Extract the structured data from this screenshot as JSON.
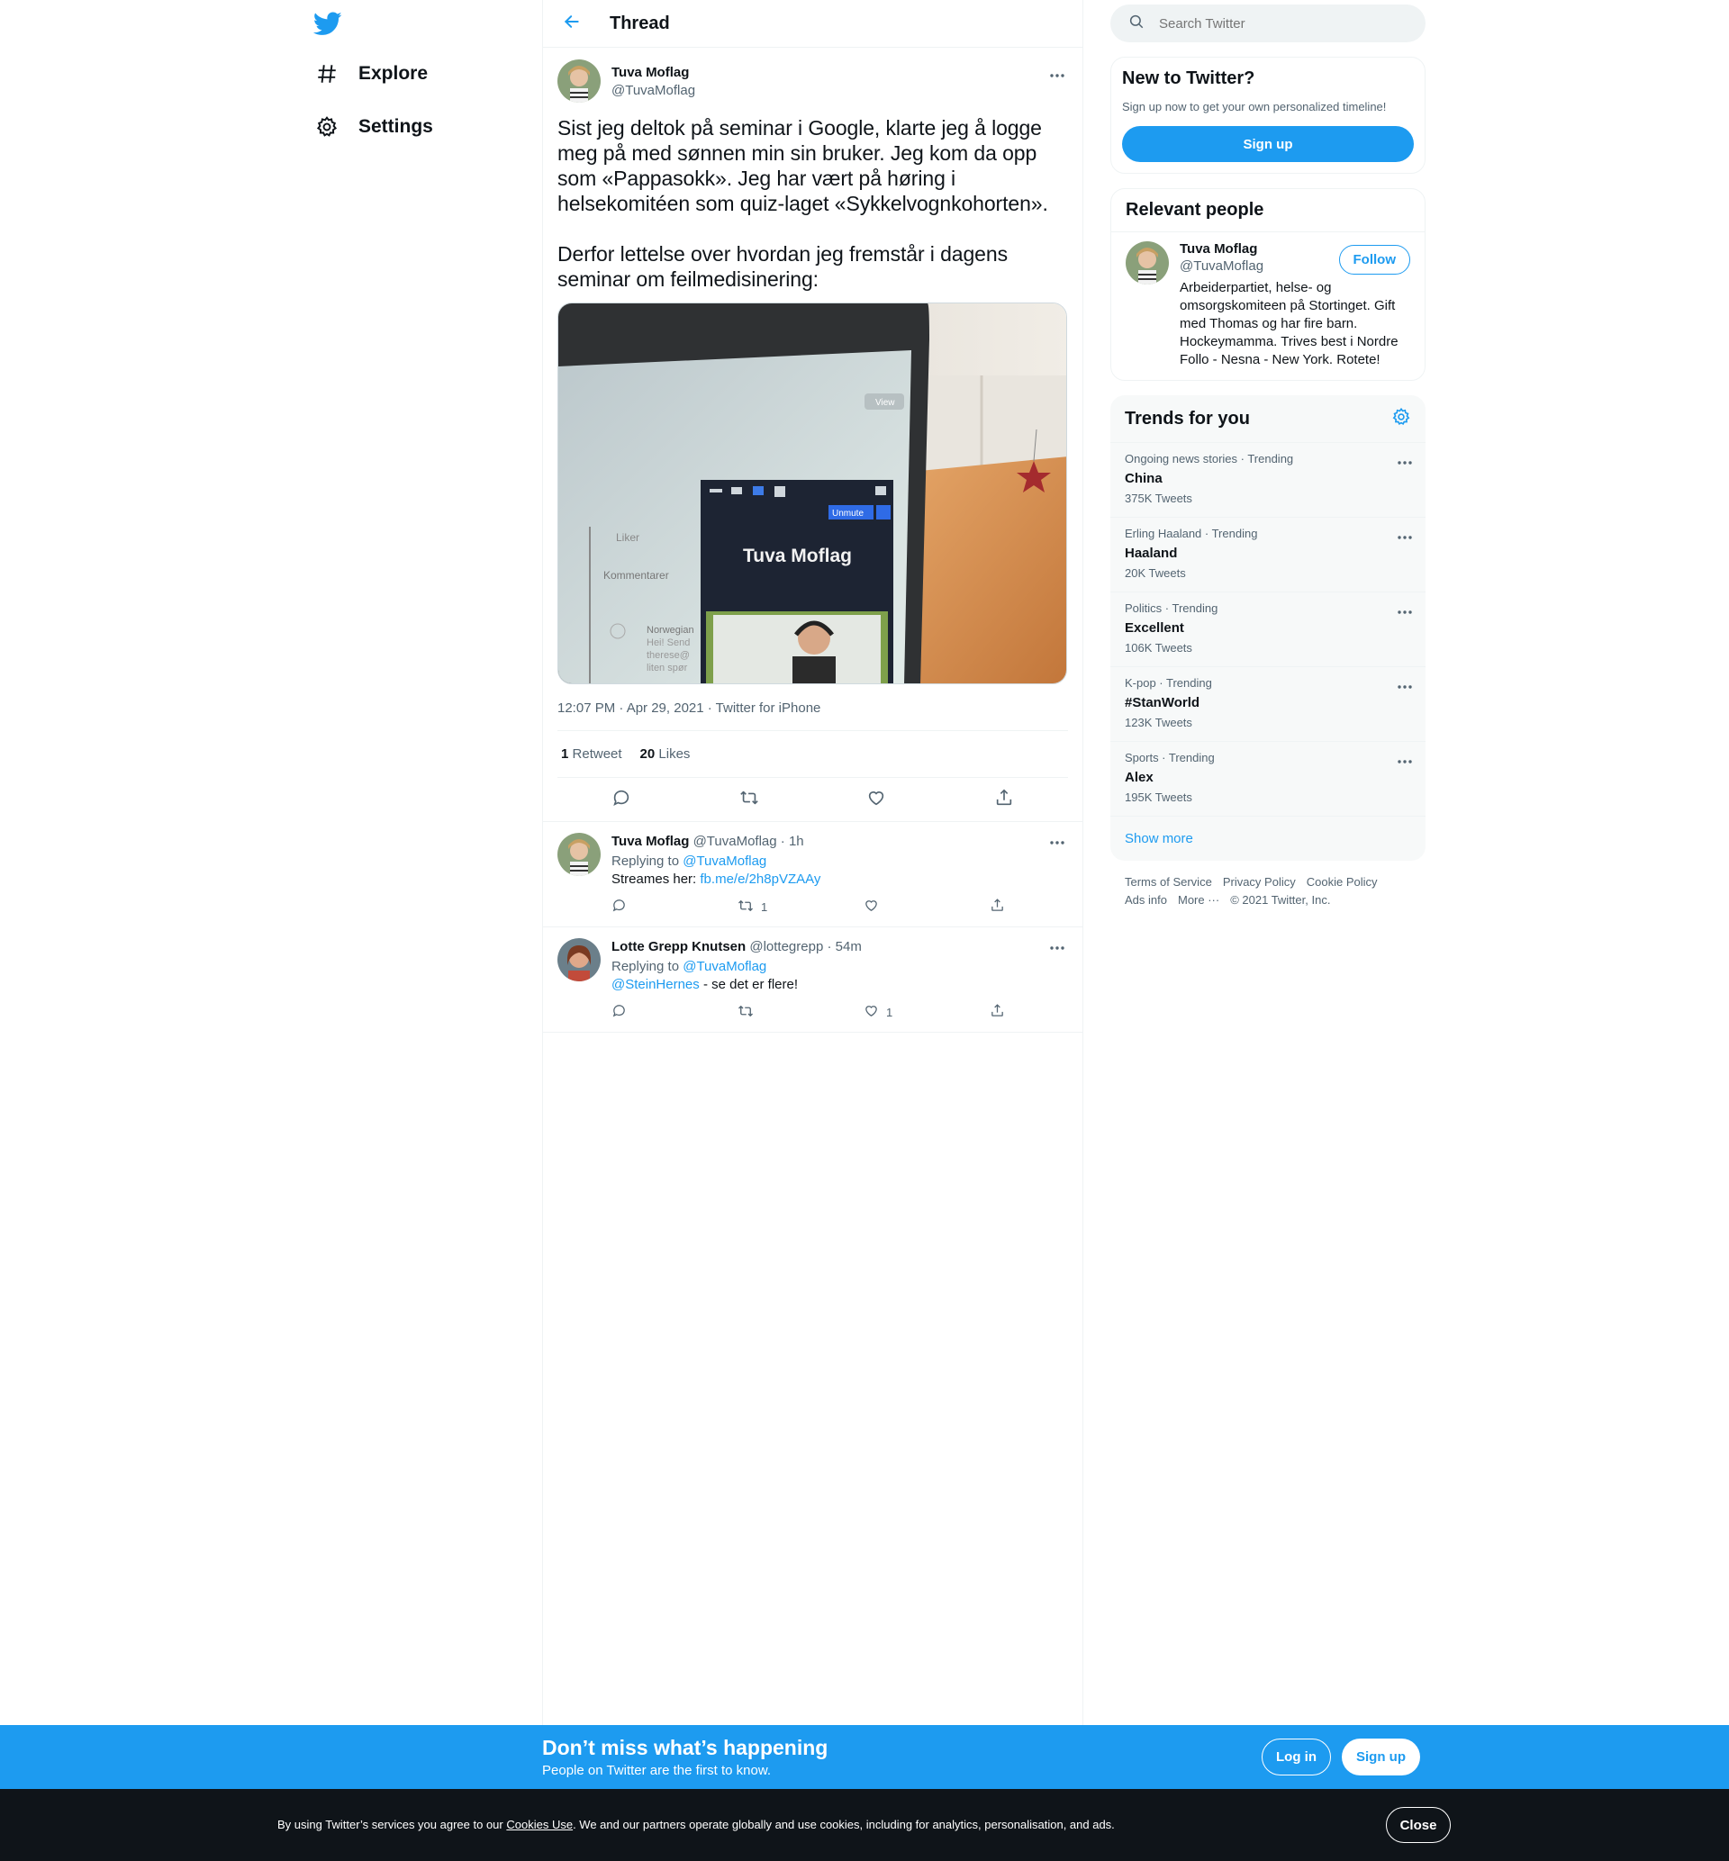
{
  "colors": {
    "brand": "#1d9bf0",
    "text": "#0f1419",
    "muted": "#536471",
    "banner": "#1d9bf0",
    "cookie_bar": "#0f1419"
  },
  "leftnav": {
    "logo_icon": "twitter-bird-icon",
    "items": [
      {
        "label": "Explore",
        "icon": "hashtag-icon"
      },
      {
        "label": "Settings",
        "icon": "gear-icon"
      }
    ]
  },
  "header": {
    "title": "Thread",
    "back_icon": "arrow-left-icon"
  },
  "tweet": {
    "name": "Tuva Moflag",
    "handle": "@TuvaMoflag",
    "text": "Sist jeg deltok på seminar i Google, klarte jeg å logge meg på med sønnen min sin bruker. Jeg kom da opp som «Pappasokk». Jeg har vært på høring i helsekomitéen som quiz-laget «Sykkelvognkohorten».\n\nDerfor lettelse over hvordan jeg fremstår i dagens seminar om feilmedisinering:",
    "media_text": {
      "name": "Tuva Moflag",
      "unmute": "Unmute",
      "view": "View",
      "likes": "Liker",
      "comments": "Kommentarer",
      "comment_lines": [
        "Norwegian",
        "Hei! Send",
        "therese@",
        "liten spør"
      ]
    },
    "timestamp": "12:07 PM · Apr 29, 2021 · Twitter for iPhone",
    "retweets": "1",
    "retweets_label": "Retweet",
    "likes": "20",
    "likes_label": "Likes"
  },
  "replies": [
    {
      "name": "Tuva Moflag",
      "handle": "@TuvaMoflag",
      "time": "· 1h",
      "replying_prefix": "Replying to",
      "replying_to": "@TuvaMoflag",
      "text_prefix": "Streames her:",
      "link": "fb.me/e/2h8pVZAAy",
      "mention": "",
      "text_suffix": "",
      "retweet_count": "1",
      "like_count": ""
    },
    {
      "name": "Lotte Grepp Knutsen",
      "handle": "@lottegrepp",
      "time": "· 54m",
      "replying_prefix": "Replying to",
      "replying_to": "@TuvaMoflag",
      "text_prefix": "",
      "link": "",
      "mention": "@SteinHernes",
      "text_suffix": " - se det er flere!",
      "retweet_count": "",
      "like_count": "1"
    }
  ],
  "search": {
    "placeholder": "Search Twitter"
  },
  "new_to_twitter": {
    "title": "New to Twitter?",
    "subtitle": "Sign up now to get your own personalized timeline!",
    "signup_label": "Sign up"
  },
  "relevant_people": {
    "title": "Relevant people",
    "name": "Tuva Moflag",
    "handle": "@TuvaMoflag",
    "bio": "Arbeiderpartiet, helse- og omsorgskomiteen på Stortinget. Gift med Thomas og har fire barn. Hockeymamma. Trives best i Nordre Follo - Nesna - New York. Rotete!",
    "follow_label": "Follow"
  },
  "trends": {
    "title": "Trends for you",
    "items": [
      {
        "context": "Ongoing news stories · Trending",
        "name": "China",
        "count": "375K Tweets"
      },
      {
        "context": "Erling Haaland · Trending",
        "name": "Haaland",
        "count": "20K Tweets"
      },
      {
        "context": "Politics · Trending",
        "name": "Excellent",
        "count": "106K Tweets"
      },
      {
        "context": "K-pop · Trending",
        "name": "#StanWorld",
        "count": "123K Tweets"
      },
      {
        "context": "Sports · Trending",
        "name": "Alex",
        "count": "195K Tweets"
      }
    ],
    "show_more": "Show more"
  },
  "footer": {
    "terms": "Terms of Service",
    "privacy": "Privacy Policy",
    "cookie": "Cookie Policy",
    "ads": "Ads info",
    "more": "More ···",
    "copyright": "© 2021 Twitter, Inc."
  },
  "banner": {
    "title": "Don’t miss what’s happening",
    "subtitle": "People on Twitter are the first to know.",
    "login_label": "Log in",
    "signup_label": "Sign up"
  },
  "cookie_bar": {
    "prefix": "By using Twitter’s services you agree to our ",
    "link": "Cookies Use",
    "suffix": ". We and our partners operate globally and use cookies, including for analytics, personalisation, and ads.",
    "close_label": "Close"
  }
}
